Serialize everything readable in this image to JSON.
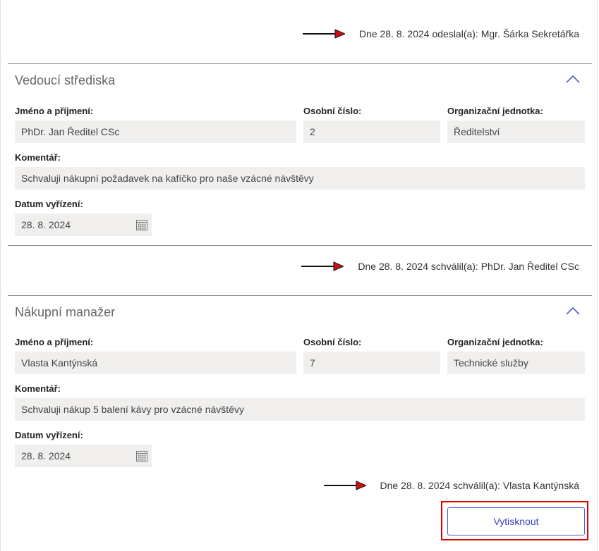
{
  "sent_line": "Dne 28. 8. 2024 odeslal(a): Mgr. Šárka Sekretářka",
  "sections": [
    {
      "title": "Vedoucí střediska",
      "name_label": "Jméno a příjmení:",
      "name_value": "PhDr. Jan Ředitel CSc",
      "number_label": "Osobní číslo:",
      "number_value": "2",
      "unit_label": "Organizační jednotka:",
      "unit_value": "Ředitelství",
      "comment_label": "Komentář:",
      "comment_value": "Schvaluji nákupní požadavek na kafíčko pro naše vzácné návštěvy",
      "date_label": "Datum vyřízení:",
      "date_value": "28. 8. 2024",
      "approval_line": "Dne 28. 8. 2024 schválil(a): PhDr. Jan Ředitel CSc"
    },
    {
      "title": "Nákupní manažer",
      "name_label": "Jméno a příjmení:",
      "name_value": "Vlasta Kantýnská",
      "number_label": "Osobní číslo:",
      "number_value": "7",
      "unit_label": "Organizační jednotka:",
      "unit_value": "Technické služby",
      "comment_label": "Komentář:",
      "comment_value": "Schvaluji nákup 5 balení kávy pro vzácné návštěvy",
      "date_label": "Datum vyřízení:",
      "date_value": "28. 8. 2024",
      "approval_line": "Dne 28. 8. 2024 schválil(a): Vlasta Kantýnská"
    }
  ],
  "print_button_label": "Vytisknout",
  "icons": {
    "collapse": "chevron-up-icon",
    "calendar": "calendar-icon",
    "pointer": "arrow-right-icon"
  },
  "colors": {
    "accent": "#3a46c8",
    "highlight": "#e00000",
    "arrow_head": "#d01010",
    "field_bg": "#f0efee"
  }
}
